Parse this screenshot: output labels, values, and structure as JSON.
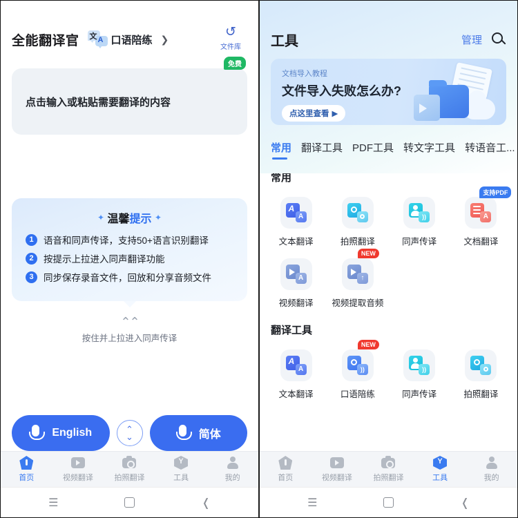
{
  "left": {
    "app_title": "全能翻译官",
    "spoken_entry": {
      "label": "口语陪练",
      "icon_text_1": "文",
      "icon_text_2": "A",
      "chevron": "❯"
    },
    "file_library": {
      "label": "文件库",
      "icon": "history-icon",
      "glyph": "↺"
    },
    "input_card": {
      "placeholder": "点击输入或粘贴需要翻译的内容",
      "badge": "免费"
    },
    "tips": {
      "title_plain": "温馨",
      "title_highlight": "提示",
      "star": "✦",
      "items": [
        {
          "num": "1",
          "text": "语音和同声传译，支持50+语言识别翻译"
        },
        {
          "num": "2",
          "text": "按提示上拉进入同声翻译功能"
        },
        {
          "num": "3",
          "text": "同步保存录音文件，回放和分享音频文件"
        }
      ]
    },
    "pullup": {
      "arrows": "⌃⌃",
      "label": "按住并上拉进入同声传译"
    },
    "language_bar": {
      "source": "English",
      "target": "简体",
      "swap_icon": "swap-vertical-icon",
      "mic_icon": "microphone-icon"
    },
    "bottom_nav": [
      {
        "label": "首页",
        "icon": "home-icon",
        "active": true
      },
      {
        "label": "视频翻译",
        "icon": "video-icon",
        "active": false
      },
      {
        "label": "拍照翻译",
        "icon": "camera-icon",
        "active": false
      },
      {
        "label": "工具",
        "icon": "tools-icon",
        "active": false
      },
      {
        "label": "我的",
        "icon": "person-icon",
        "active": false
      }
    ]
  },
  "right": {
    "title": "工具",
    "manage_label": "管理",
    "search_icon": "search-icon",
    "banner": {
      "kicker": "文档导入教程",
      "title": "文件导入失败怎么办?",
      "cta": "点这里查看",
      "cta_arrow": "▶",
      "dots_total": 3,
      "dots_active_index": 2
    },
    "tabs": [
      {
        "label": "常用",
        "active": true
      },
      {
        "label": "翻译工具",
        "active": false
      },
      {
        "label": "PDF工具",
        "active": false
      },
      {
        "label": "转文字工具",
        "active": false
      },
      {
        "label": "转语音工...",
        "active": false
      }
    ],
    "sections": [
      {
        "title": "常用",
        "items": [
          {
            "label": "文本翻译",
            "icon": "text-translate-icon",
            "color": "#4a6ef0",
            "badge": null
          },
          {
            "label": "拍照翻译",
            "icon": "photo-translate-icon",
            "color": "#23b7e8",
            "badge": null
          },
          {
            "label": "同声传译",
            "icon": "simultaneous-interpret-icon",
            "color": "#1fc0df",
            "badge": null
          },
          {
            "label": "文档翻译",
            "icon": "document-translate-icon",
            "color": "#ef5b57",
            "badge": "支持PDF",
            "badge_type": "pdf"
          },
          {
            "label": "视频翻译",
            "icon": "video-translate-icon",
            "color": "#6f8fd6",
            "badge": null
          },
          {
            "label": "视频提取音频",
            "icon": "video-extract-audio-icon",
            "color": "#6f8fd6",
            "badge": "NEW",
            "badge_type": "new"
          }
        ]
      },
      {
        "title": "翻译工具",
        "items": [
          {
            "label": "文本翻译",
            "icon": "text-translate-icon",
            "color": "#4a6ef0",
            "badge": null
          },
          {
            "label": "口语陪练",
            "icon": "spoken-practice-icon",
            "color": "#4a8ef0",
            "badge": "NEW",
            "badge_type": "new"
          },
          {
            "label": "同声传译",
            "icon": "simultaneous-interpret-icon",
            "color": "#1fc0df",
            "badge": null
          },
          {
            "label": "拍照翻译",
            "icon": "photo-translate-icon",
            "color": "#23b7e8",
            "badge": null
          }
        ]
      }
    ],
    "bottom_nav": [
      {
        "label": "首页",
        "icon": "home-icon",
        "active": false
      },
      {
        "label": "视频翻译",
        "icon": "video-icon",
        "active": false
      },
      {
        "label": "拍照翻译",
        "icon": "camera-icon",
        "active": false
      },
      {
        "label": "工具",
        "icon": "tools-icon",
        "active": true
      },
      {
        "label": "我的",
        "icon": "person-icon",
        "active": false
      }
    ]
  },
  "system_nav": {
    "menu": "☰",
    "home": "square",
    "back": "❬"
  },
  "colors": {
    "primary_blue": "#3a7bf0",
    "badge_green": "#1fb864",
    "badge_red": "#f0392e"
  }
}
